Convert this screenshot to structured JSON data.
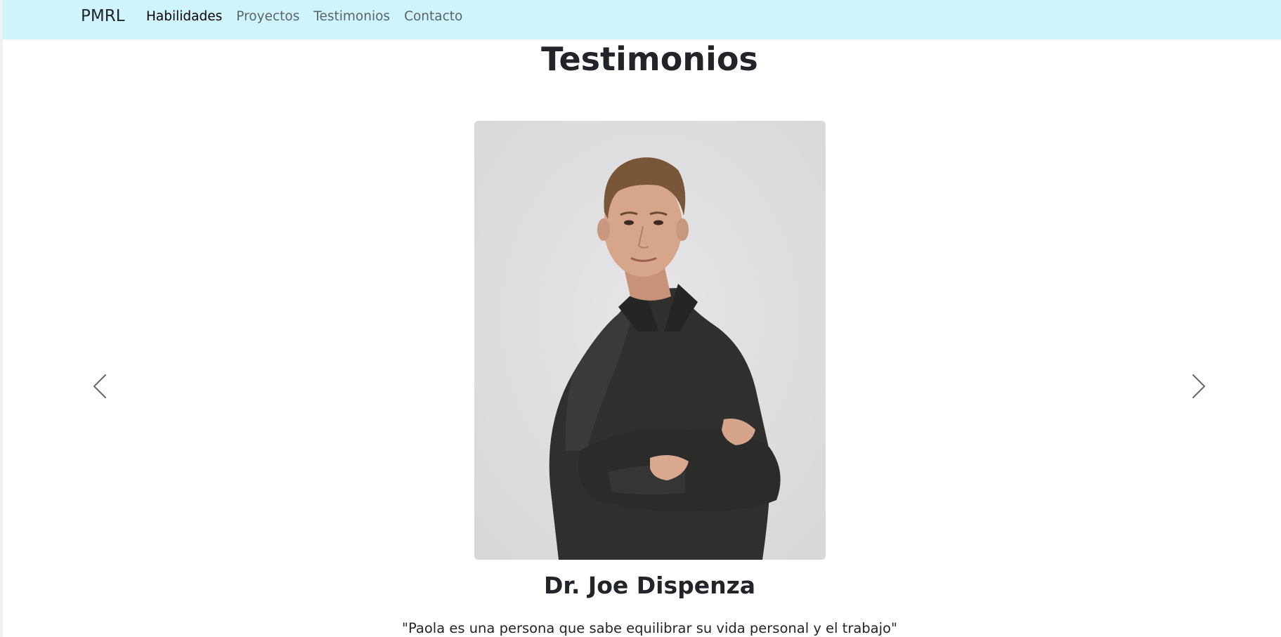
{
  "navbar": {
    "brand": "PMRL",
    "links": [
      {
        "label": "Habilidades",
        "active": true
      },
      {
        "label": "Proyectos",
        "active": false
      },
      {
        "label": "Testimonios",
        "active": false
      },
      {
        "label": "Contacto",
        "active": false
      }
    ],
    "background_color": "#cff4fc"
  },
  "section": {
    "title": "Testimonios"
  },
  "carousel": {
    "prev_icon": "chevron-left-icon",
    "next_icon": "chevron-right-icon",
    "active_item": {
      "photo": "portrait-photo",
      "name": "Dr. Joe Dispenza",
      "quote": "\"Paola es una persona que sabe equilibrar su vida personal y el trabajo\""
    }
  }
}
